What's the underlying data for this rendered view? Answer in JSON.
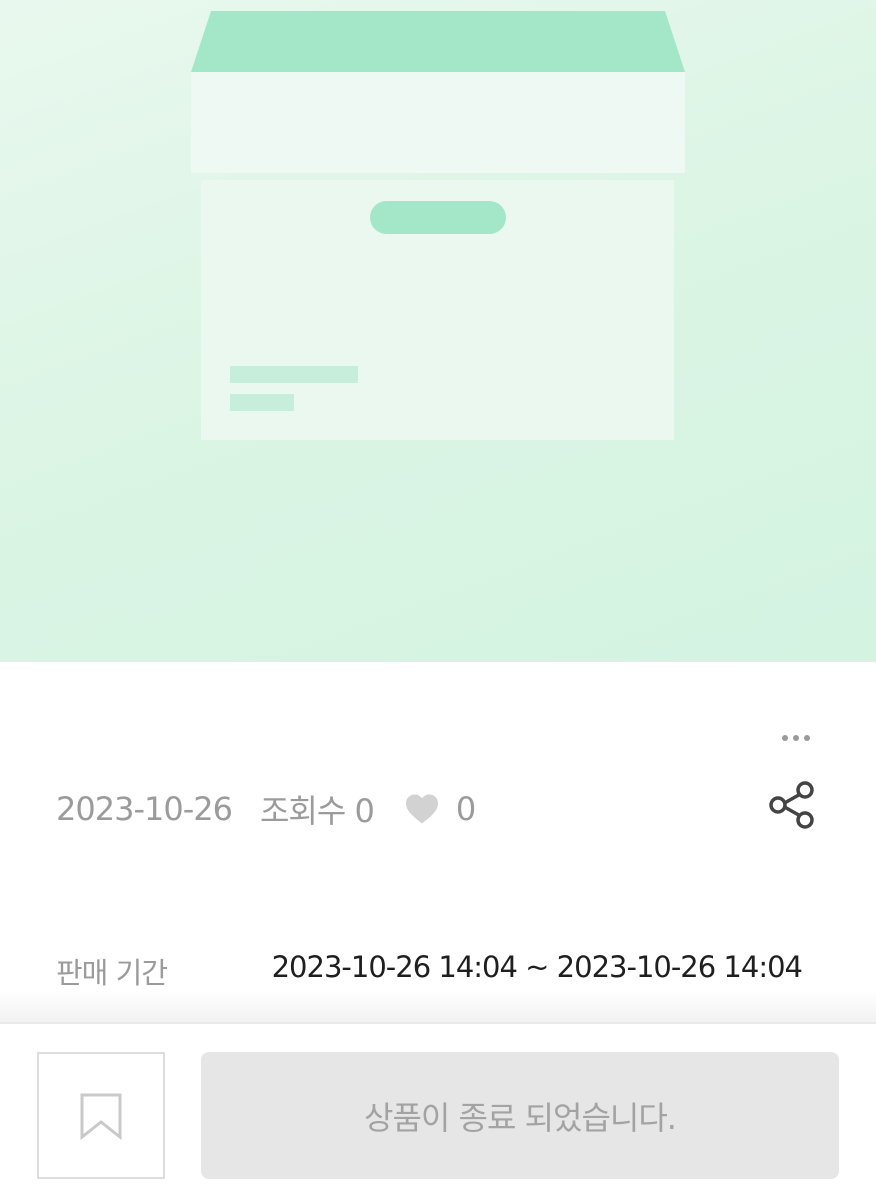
{
  "hero": {
    "image": "archive-box-placeholder",
    "colors": {
      "background": "#d9f4e4",
      "lid_top": "#a4e6c8",
      "box_face": "#eef9f3",
      "handle": "#a4e6c8",
      "label_lines": "#c6eedb"
    }
  },
  "actions": {
    "more_icon": "more-horizontal-icon",
    "share_icon": "share-icon"
  },
  "meta": {
    "date": "2023-10-26",
    "views": "조회수 0",
    "like_icon": "heart-icon",
    "likes": "0"
  },
  "sale_period": {
    "label": "판매 기간",
    "value": "2023-10-26 14:04 ~ 2023-10-26 14:04"
  },
  "bottom_bar": {
    "bookmark_icon": "bookmark-icon",
    "status_button": "상품이 종료 되었습니다."
  }
}
